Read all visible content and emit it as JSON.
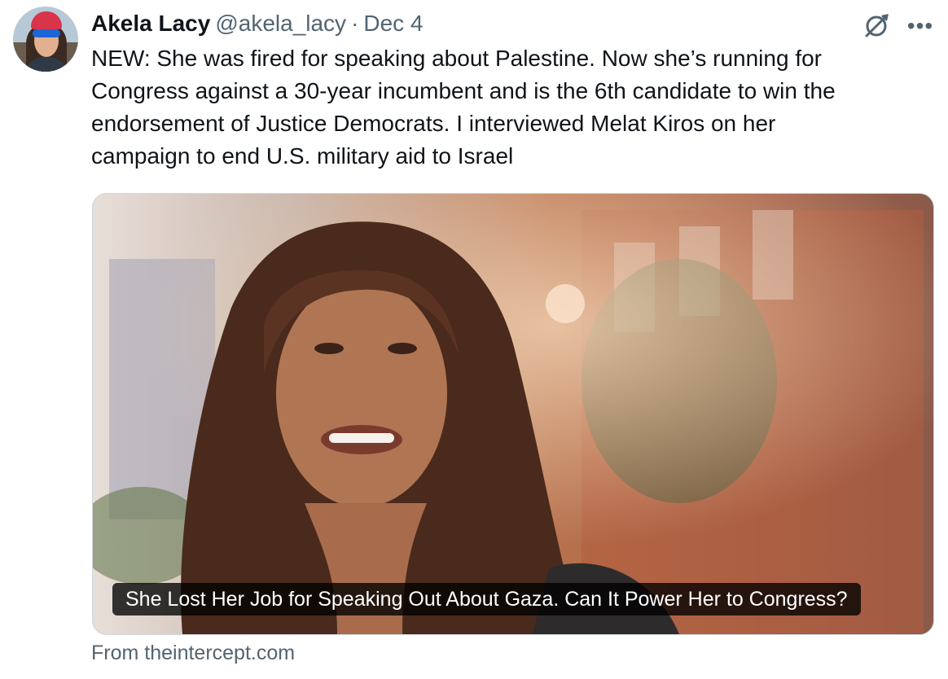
{
  "author": {
    "name": "Akela Lacy",
    "handle": "@akela_lacy",
    "separator": "·",
    "date": "Dec 4"
  },
  "tweet": {
    "text": "NEW: She was fired for speaking about Palestine. Now she’s running for\nCongress against a 30-year incumbent and is the 6th candidate to win the\nendorsement of Justice Democrats. I interviewed Melat Kiros on her\ncampaign to end U.S. military aid to Israel"
  },
  "card": {
    "caption": "She Lost Her Job for Speaking Out About Gaza. Can It Power Her to Congress?",
    "source": "From theintercept.com"
  },
  "icons": {
    "grok": "grok-icon",
    "more": "more-icon"
  },
  "colors": {
    "text": "#0f1419",
    "secondary": "#536471",
    "border": "#cfd9de"
  }
}
